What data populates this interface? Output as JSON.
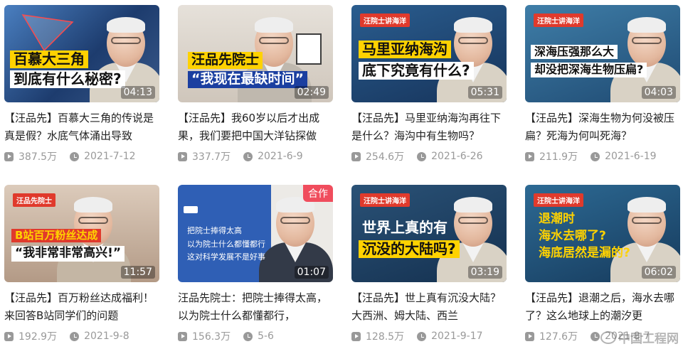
{
  "videos": [
    {
      "headline": [
        "百慕大三角",
        "到底有什么秘密?"
      ],
      "tag": "",
      "duration": "04:13",
      "badge": "",
      "title": "【汪品先】百慕大三角的传说是真是假？水底气体涌出导致",
      "views": "387.5万",
      "date": "2021-7-12",
      "bg": "#1d3c6e"
    },
    {
      "headline": [
        "汪品先院士",
        "“我现在最缺时间”"
      ],
      "tag": "",
      "duration": "02:49",
      "badge": "",
      "title": "【汪品先】我60岁以后才出成果，我们要把中国大洋钻探做",
      "views": "337.7万",
      "date": "2021-6-9",
      "bg": "#d8d3cc"
    },
    {
      "headline": [
        "马里亚纳海沟",
        "底下究竟有什么?"
      ],
      "tag": "汪院士讲海洋",
      "duration": "05:31",
      "badge": "",
      "title": "【汪品先】马里亚纳海沟再往下是什么？海沟中有生物吗？",
      "views": "254.6万",
      "date": "2021-6-26",
      "bg": "#1b3d66"
    },
    {
      "headline": [
        "深海压强那么大",
        "却没把深海生物压扁?"
      ],
      "tag": "汪院士讲海洋",
      "duration": "04:03",
      "badge": "",
      "title": "【汪品先】深海生物为何没被压扁？死海为何叫死海？",
      "views": "211.9万",
      "date": "2021-6-19",
      "bg": "#2b5f86"
    },
    {
      "headline": [
        "B站百万粉丝达成",
        "“我非常非常高兴!”"
      ],
      "tag": "汪品先院士",
      "duration": "11:57",
      "badge": "",
      "title": "【汪品先】百万粉丝达成福利！来回答B站同学们的问题",
      "views": "192.9万",
      "date": "2021-9-8",
      "bg": "#c9b7a6"
    },
    {
      "headline": [
        "把院士捧得太高",
        "以为院士什么都懂都行",
        "这对科学发展不是好事"
      ],
      "tag": "",
      "duration": "01:07",
      "badge": "合作",
      "title": "汪品先院士：把院士捧得太高，以为院士什么都懂都行，",
      "views": "156.3万",
      "date": "5-6",
      "bg": "#2f5fb5"
    },
    {
      "headline": [
        "世界上真的有",
        "沉没的大陆吗?"
      ],
      "tag": "汪院士讲海洋",
      "duration": "03:19",
      "badge": "",
      "title": "【汪品先】世上真有沉没大陆？大西洲、姆大陆、西兰",
      "views": "128.5万",
      "date": "2021-9-17",
      "bg": "#1d3f63"
    },
    {
      "headline": [
        "退潮时",
        "海水去哪了?",
        "海底居然是漏的?"
      ],
      "tag": "汪院士讲海洋",
      "duration": "06:02",
      "badge": "",
      "title": "【汪品先】退潮之后，海水去哪了？这么地球上的潮汐更",
      "views": "127.6万",
      "date": "2021-8-7",
      "bg": "#1f4a72"
    }
  ],
  "watermark": "中国工程网",
  "colors": {
    "accent_yellow": "#ffd200",
    "tag_red": "#e03a2c",
    "meta_gray": "#999999"
  }
}
